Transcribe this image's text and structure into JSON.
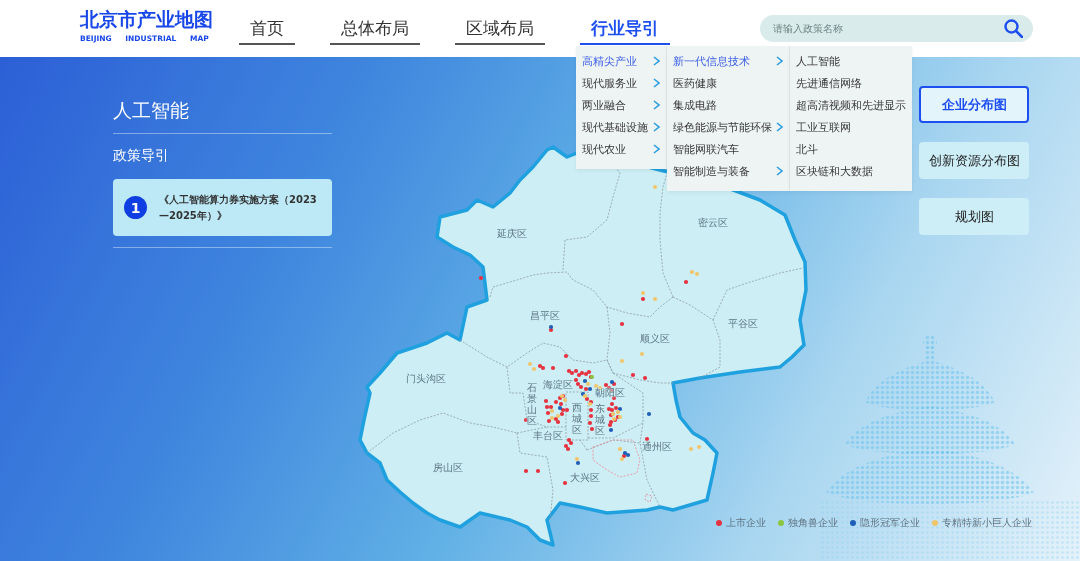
{
  "header": {
    "logo": {
      "title": "北京市产业地图",
      "subtitle": "BEIJING INDUSTRIAL MAP"
    },
    "nav_tabs": [
      {
        "label": "首页",
        "selected": false
      },
      {
        "label": "总体布局",
        "selected": false
      },
      {
        "label": "区域布局",
        "selected": false
      },
      {
        "label": "行业导引",
        "selected": true
      }
    ],
    "search": {
      "placeholder": "请输入政策名称"
    }
  },
  "industry_menu": {
    "columns": [
      {
        "items": [
          {
            "label": "高精尖产业",
            "selected": true,
            "expandable": true
          },
          {
            "label": "现代服务业",
            "selected": false,
            "expandable": true
          },
          {
            "label": "两业融合",
            "selected": false,
            "expandable": true
          },
          {
            "label": "现代基础设施",
            "selected": false,
            "expandable": true
          },
          {
            "label": "现代农业",
            "selected": false,
            "expandable": true
          }
        ]
      },
      {
        "items": [
          {
            "label": "新一代信息技术",
            "selected": true,
            "expandable": true
          },
          {
            "label": "医药健康",
            "selected": false,
            "expandable": false
          },
          {
            "label": "集成电路",
            "selected": false,
            "expandable": false
          },
          {
            "label": "绿色能源与节能环保",
            "selected": false,
            "expandable": true
          },
          {
            "label": "智能网联汽车",
            "selected": false,
            "expandable": false
          },
          {
            "label": "智能制造与装备",
            "selected": false,
            "expandable": true
          }
        ]
      },
      {
        "items": [
          {
            "label": "人工智能",
            "selected": false,
            "expandable": false
          },
          {
            "label": "先进通信网络",
            "selected": false,
            "expandable": false
          },
          {
            "label": "超高清视频和先进显示",
            "selected": false,
            "expandable": false
          },
          {
            "label": "工业互联网",
            "selected": false,
            "expandable": false
          },
          {
            "label": "北斗",
            "selected": false,
            "expandable": false
          },
          {
            "label": "区块链和大数据",
            "selected": false,
            "expandable": false
          }
        ]
      }
    ]
  },
  "policy_panel": {
    "title": "人工智能",
    "section_title": "政策导引",
    "policies": [
      {
        "number": "1",
        "title": "《人工智能算力券实施方案（2023—2025年）》"
      }
    ]
  },
  "map": {
    "districts": [
      {
        "label": "延庆区",
        "kind": "horizontal"
      },
      {
        "label": "密云区",
        "kind": "horizontal"
      },
      {
        "label": "昌平区",
        "kind": "horizontal"
      },
      {
        "label": "平谷区",
        "kind": "horizontal"
      },
      {
        "label": "顺义区",
        "kind": "horizontal"
      },
      {
        "label": "门头沟区",
        "kind": "horizontal"
      },
      {
        "label": "海淀区",
        "kind": "horizontal"
      },
      {
        "label": "朝阳区",
        "kind": "horizontal"
      },
      {
        "label": "石景山区",
        "kind": "vertical"
      },
      {
        "label": "丰台区",
        "kind": "horizontal"
      },
      {
        "label": "西城区",
        "kind": "vertical"
      },
      {
        "label": "东城区",
        "kind": "vertical"
      },
      {
        "label": "通州区",
        "kind": "horizontal"
      },
      {
        "label": "房山区",
        "kind": "horizontal"
      },
      {
        "label": "大兴区",
        "kind": "horizontal"
      }
    ],
    "legend": [
      {
        "label": "上市企业",
        "color": "#e5323f"
      },
      {
        "label": "独角兽企业",
        "color": "#8cc63f"
      },
      {
        "label": "隐形冠军企业",
        "color": "#1f5fb8"
      },
      {
        "label": "专精特新小巨人企业",
        "color": "#f0c66c"
      }
    ]
  },
  "view_buttons": [
    {
      "label": "企业分布图",
      "selected": true
    },
    {
      "label": "创新资源分布图",
      "selected": false
    },
    {
      "label": "规划图",
      "selected": false
    }
  ]
}
